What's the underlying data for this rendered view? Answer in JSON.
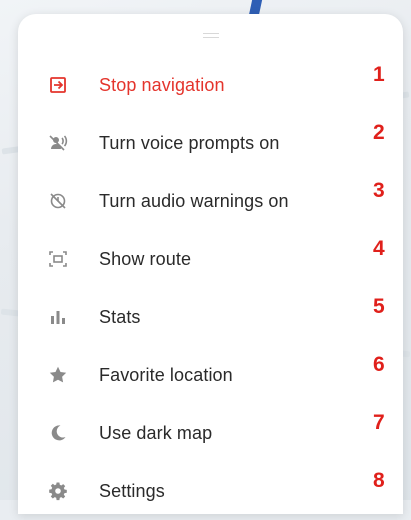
{
  "menu": {
    "items": [
      {
        "label": "Stop navigation",
        "icon": "exit-navigation-icon",
        "number": "1",
        "accent": "#e4342c"
      },
      {
        "label": "Turn voice prompts on",
        "icon": "voice-off-icon",
        "number": "2"
      },
      {
        "label": "Turn audio warnings on",
        "icon": "audio-warnings-off-icon",
        "number": "3"
      },
      {
        "label": "Show route",
        "icon": "route-overview-icon",
        "number": "4"
      },
      {
        "label": "Stats",
        "icon": "stats-icon",
        "number": "5"
      },
      {
        "label": "Favorite location",
        "icon": "star-icon",
        "number": "6"
      },
      {
        "label": "Use dark map",
        "icon": "moon-icon",
        "number": "7"
      },
      {
        "label": "Settings",
        "icon": "gear-icon",
        "number": "8"
      }
    ]
  },
  "colors": {
    "accent_red": "#e4342c",
    "annotation_red": "#e0201b",
    "icon_gray": "#8a8a8a",
    "text": "#2a2a2a"
  }
}
